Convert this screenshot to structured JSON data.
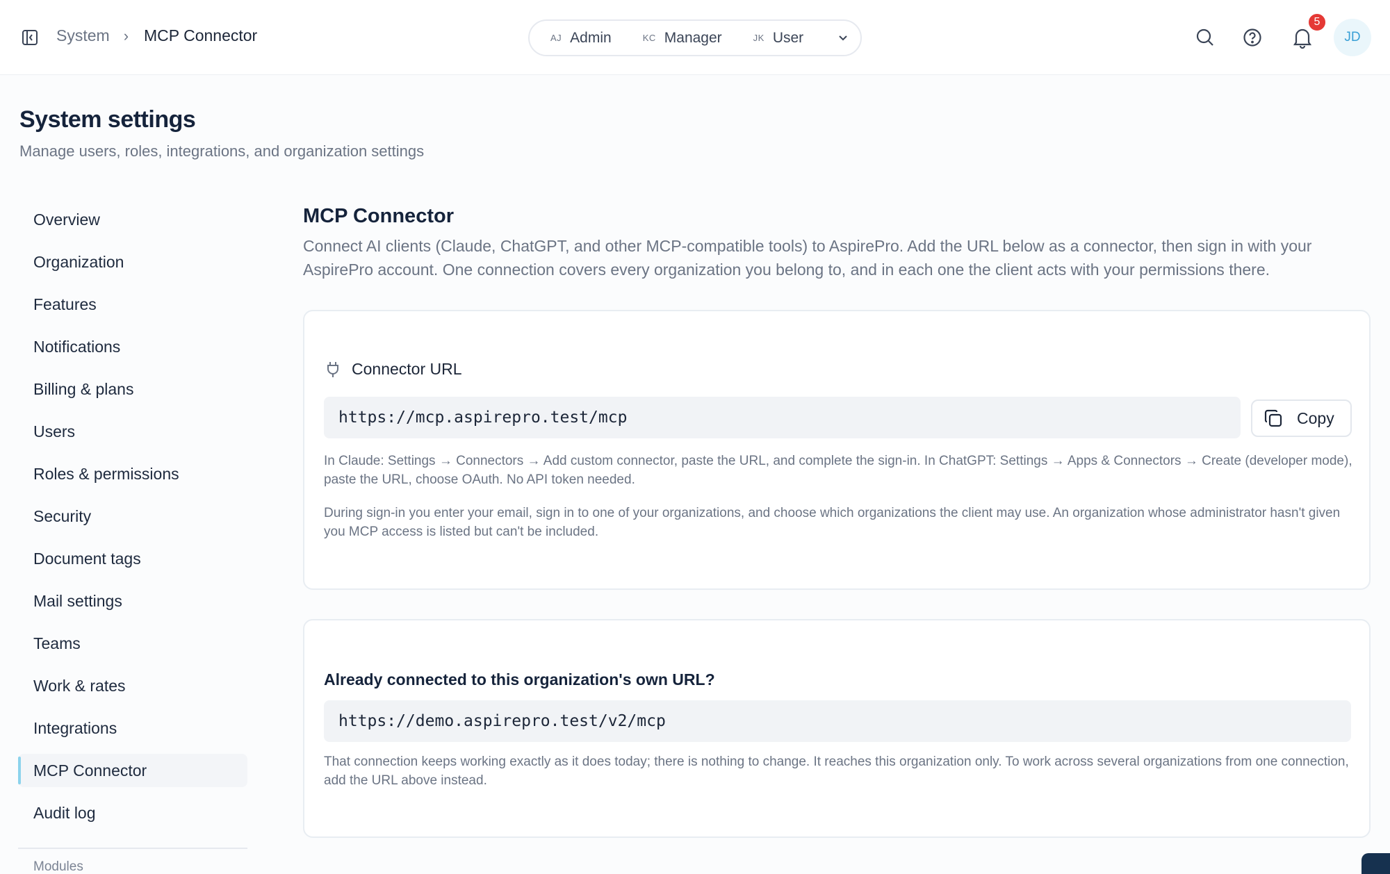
{
  "topbar": {
    "breadcrumb": {
      "root": "System",
      "separator": "›",
      "current": "MCP Connector"
    },
    "roles": [
      {
        "initials": "AJ",
        "label": "Admin"
      },
      {
        "initials": "KC",
        "label": "Manager"
      },
      {
        "initials": "JK",
        "label": "User"
      }
    ],
    "notification_count": "5",
    "avatar_initials": "JD",
    "icons": [
      "sidebar-toggle-icon",
      "search-icon",
      "help-icon",
      "bell-icon"
    ]
  },
  "page": {
    "title": "System settings",
    "subtitle": "Manage users, roles, integrations, and organization settings"
  },
  "nav": {
    "items": [
      {
        "label": "Overview"
      },
      {
        "label": "Organization"
      },
      {
        "label": "Features"
      },
      {
        "label": "Notifications"
      },
      {
        "label": "Billing & plans"
      },
      {
        "label": "Users"
      },
      {
        "label": "Roles & permissions"
      },
      {
        "label": "Security"
      },
      {
        "label": "Document tags"
      },
      {
        "label": "Mail settings"
      },
      {
        "label": "Teams"
      },
      {
        "label": "Work & rates"
      },
      {
        "label": "Integrations"
      },
      {
        "label": "MCP Connector"
      },
      {
        "label": "Audit log"
      }
    ],
    "active": "MCP Connector",
    "section_label": "Modules"
  },
  "main": {
    "title": "MCP Connector",
    "description": "Connect AI clients (Claude, ChatGPT, and other MCP-compatible tools) to AspirePro. Add the URL below as a connector, then sign in with your AspirePro account. One connection covers every organization you belong to, and in each one the client acts with your permissions there.",
    "connector": {
      "heading": "Connector URL",
      "url": "https://mcp.aspirepro.test/mcp",
      "copy_label": "Copy",
      "help_1": "In Claude: Settings → Connectors → Add custom connector, paste the URL, and complete the sign-in. In ChatGPT: Settings → Apps & Connectors → Create (developer mode), paste the URL, choose OAuth. No API token needed.",
      "help_2": "During sign-in you enter your email, sign in to one of your organizations, and choose which organizations the client may use. An organization whose administrator hasn't given you MCP access is listed but can't be included."
    },
    "legacy": {
      "heading": "Already connected to this organization's own URL?",
      "url": "https://demo.aspirepro.test/v2/mcp",
      "help": "That connection keeps working exactly as it does today; there is nothing to change. It reaches this organization only. To work across several organizations from one connection, add the URL above instead."
    }
  },
  "colors": {
    "accent": "#8cd3ec",
    "badge": "#e53935",
    "avatar_bg": "#eaf6fb",
    "avatar_text": "#3aa0d6"
  }
}
